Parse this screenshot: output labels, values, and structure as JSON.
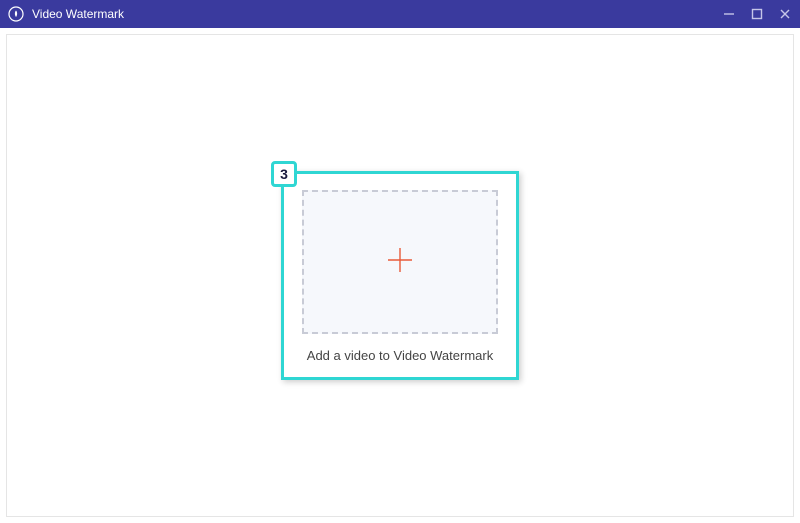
{
  "titlebar": {
    "app_title": "Video Watermark"
  },
  "highlight": {
    "badge_number": "3"
  },
  "dropzone": {
    "label": "Add a video to Video Watermark"
  },
  "colors": {
    "titlebar_bg": "#3a3a9e",
    "highlight_border": "#2fd6d3",
    "plus_icon": "#e85a3a"
  }
}
